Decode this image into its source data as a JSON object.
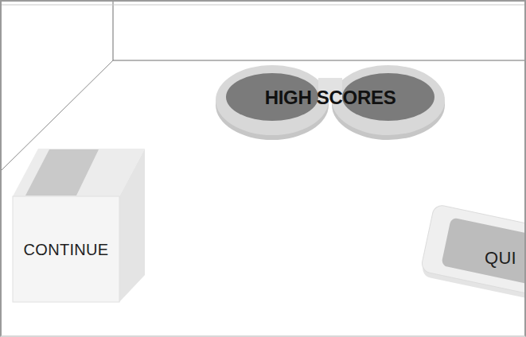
{
  "menu": {
    "items": [
      {
        "label": "HIGH SCORES",
        "kind": "discs"
      },
      {
        "label": "CONTINUE",
        "kind": "box"
      },
      {
        "label": "QUI",
        "kind": "tray"
      }
    ]
  }
}
